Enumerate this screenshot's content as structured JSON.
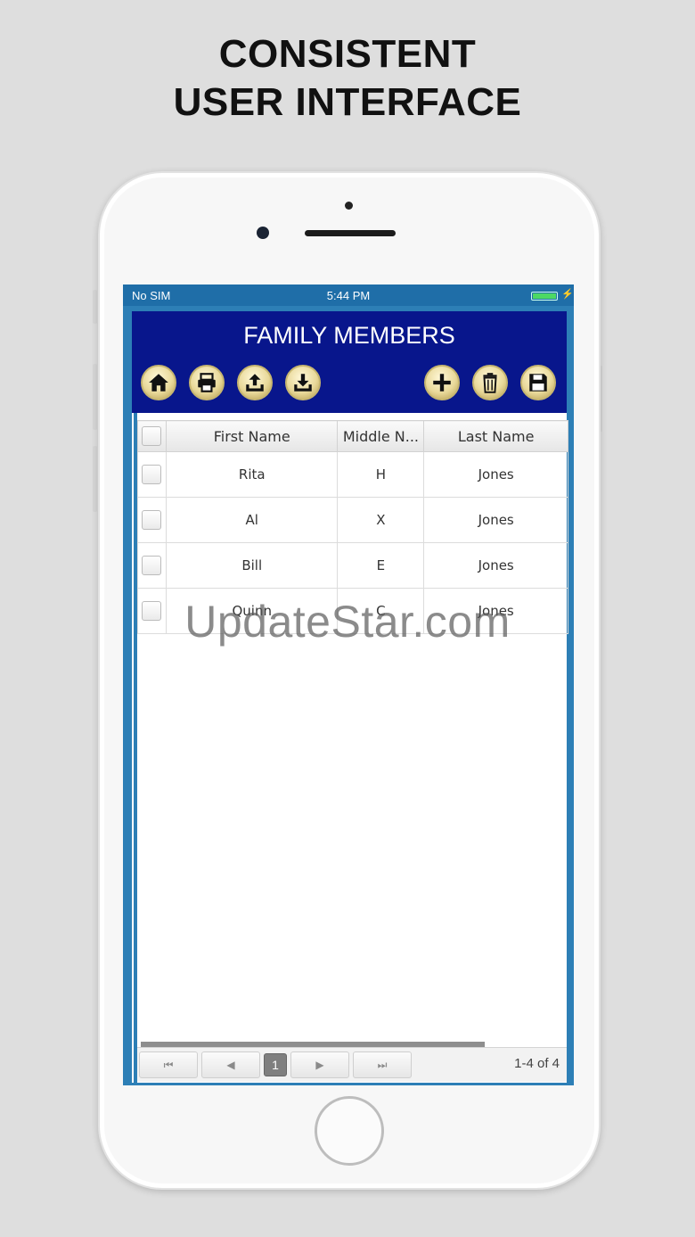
{
  "headline": {
    "line1": "CONSISTENT",
    "line2": "USER INTERFACE"
  },
  "status_bar": {
    "carrier": "No SIM",
    "time": "5:44 PM",
    "battery_color": "#4cd964",
    "charging_icon": "bolt-icon"
  },
  "app": {
    "title": "FAMILY MEMBERS",
    "title_bg": "#08168c",
    "toolbar_left": [
      "home-icon",
      "print-icon",
      "upload-icon",
      "download-icon"
    ],
    "toolbar_right": [
      "add-icon",
      "trash-icon",
      "save-icon"
    ]
  },
  "grid": {
    "columns": [
      "First Name",
      "Middle N...",
      "Last Name"
    ],
    "rows": [
      {
        "first": "Rita",
        "middle": "H",
        "last": "Jones"
      },
      {
        "first": "Al",
        "middle": "X",
        "last": "Jones"
      },
      {
        "first": "Bill",
        "middle": "E",
        "last": "Jones"
      },
      {
        "first": "Quinn",
        "middle": "C",
        "last": "Jones"
      }
    ]
  },
  "pager": {
    "current_page": "1",
    "info": "1-4 of 4",
    "buttons": [
      "first-page-icon",
      "prev-page-icon",
      "next-page-icon",
      "last-page-icon"
    ]
  },
  "watermark": "UpdateStar.com"
}
